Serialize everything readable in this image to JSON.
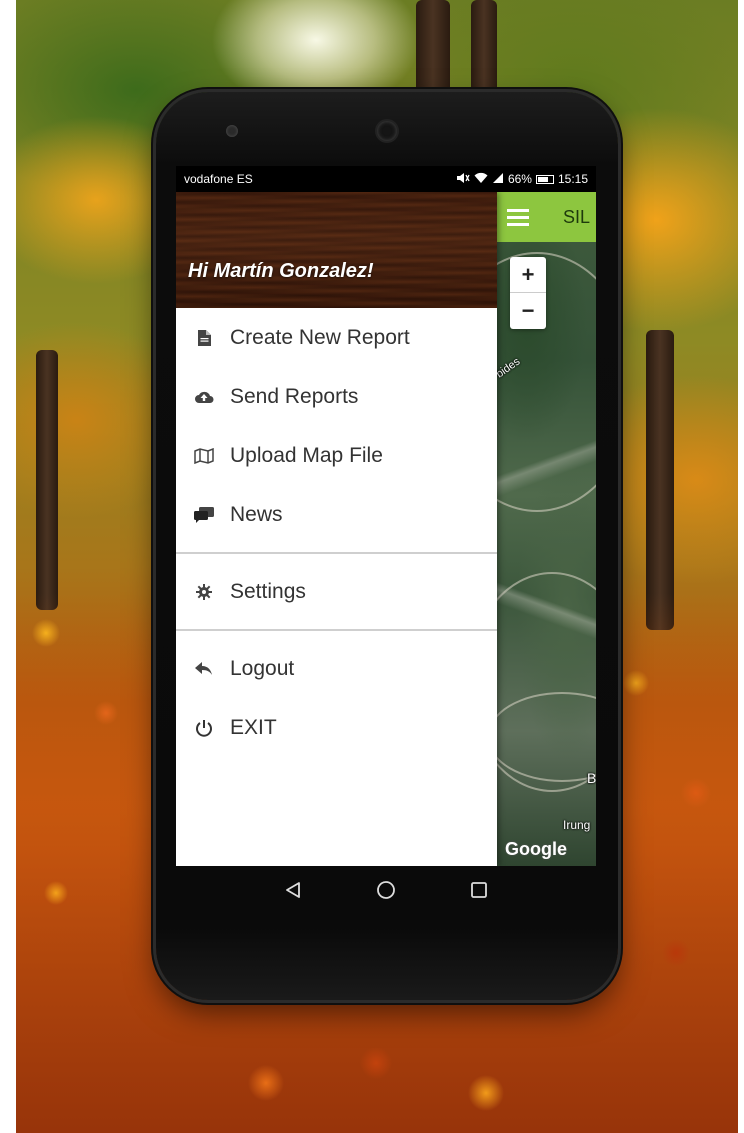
{
  "status_bar": {
    "carrier": "vodafone ES",
    "battery_percent": "66%",
    "time": "15:15",
    "icons": [
      "mute-icon",
      "wifi-icon",
      "signal-icon",
      "battery-icon"
    ]
  },
  "drawer": {
    "greeting": "Hi Martín Gonzalez!",
    "items": [
      {
        "label": "Create New Report",
        "icon": "document-icon"
      },
      {
        "label": "Send Reports",
        "icon": "cloud-upload-icon"
      },
      {
        "label": "Upload Map File",
        "icon": "map-icon"
      },
      {
        "label": "News",
        "icon": "chat-bubbles-icon"
      }
    ],
    "settings": {
      "label": "Settings",
      "icon": "gear-icon"
    },
    "bottom_items": [
      {
        "label": "Logout",
        "icon": "reply-arrow-icon"
      },
      {
        "label": "EXIT",
        "icon": "power-icon"
      }
    ]
  },
  "appbar": {
    "title": "SIL",
    "color": "#8dc63f"
  },
  "map": {
    "zoom_in_label": "+",
    "zoom_out_label": "−",
    "labels": [
      "bides",
      "B",
      "Irung"
    ],
    "attribution": "Google"
  },
  "navbar": {
    "buttons": [
      "back-icon",
      "home-icon",
      "recents-icon"
    ]
  }
}
